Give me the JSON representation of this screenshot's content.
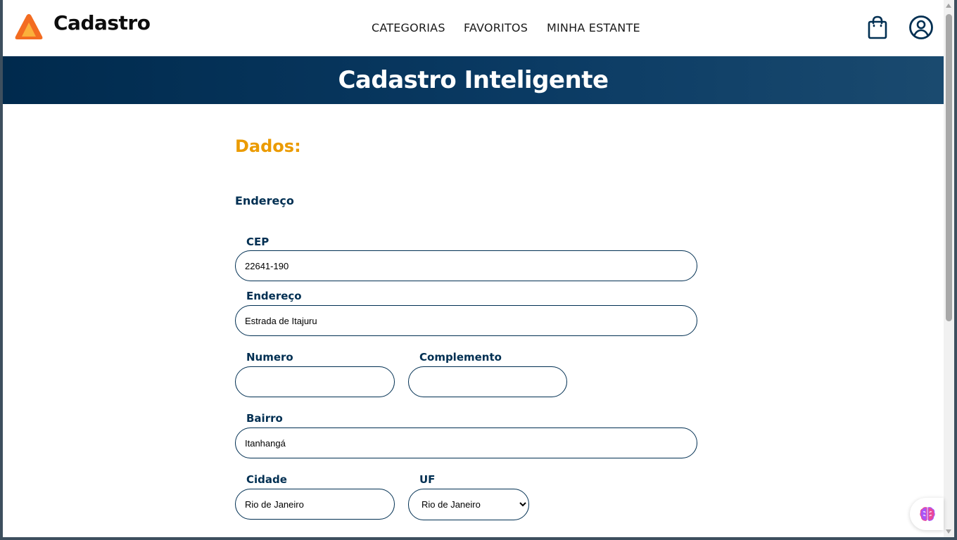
{
  "app": {
    "brand": "Cadastro",
    "nav": [
      "CATEGORIAS",
      "FAVORITOS",
      "MINHA ESTANTE"
    ],
    "icons": {
      "cart": "shopping-bag-icon",
      "profile": "user-circle-icon",
      "logo": "triangle-logo-icon",
      "assistant": "brain-icon"
    }
  },
  "banner": {
    "title": "Cadastro Inteligente"
  },
  "form": {
    "section_title": "Dados:",
    "subsection_title": "Endereço",
    "fields": {
      "cep": {
        "label": "CEP",
        "value": "22641-190"
      },
      "endereco": {
        "label": "Endereço",
        "value": "Estrada de Itajuru"
      },
      "numero": {
        "label": "Numero",
        "value": ""
      },
      "complemento": {
        "label": "Complemento",
        "value": ""
      },
      "bairro": {
        "label": "Bairro",
        "value": "Itanhangá"
      },
      "cidade": {
        "label": "Cidade",
        "value": "Rio de Janeiro"
      },
      "uf": {
        "label": "UF",
        "selected": "Rio de Janeiro"
      }
    }
  },
  "colors": {
    "accent": "#eb9b00",
    "navy": "#002f52",
    "banner_start": "#002a4d",
    "banner_end": "#1a4a6f",
    "logo_outer": "#f36c21",
    "logo_inner": "#fbb03b"
  }
}
